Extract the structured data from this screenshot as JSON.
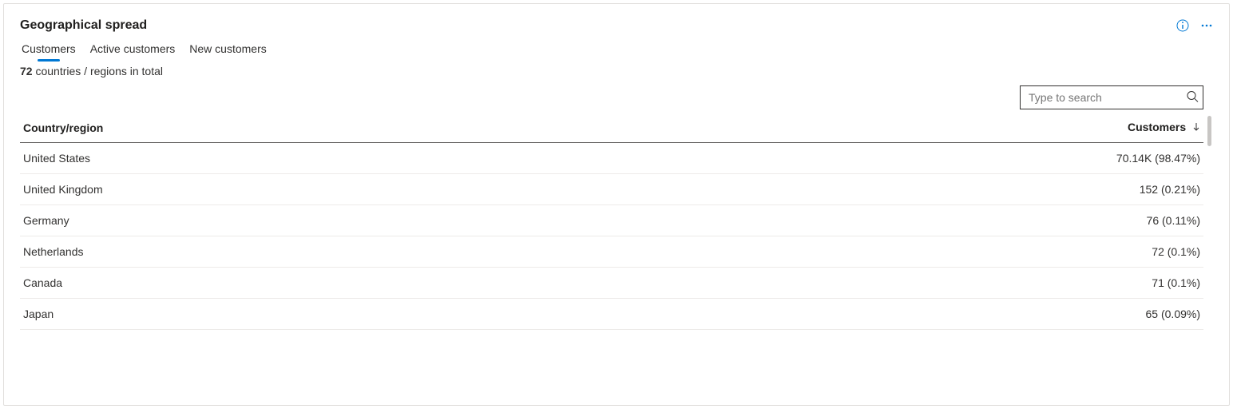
{
  "card": {
    "title": "Geographical spread"
  },
  "tabs": [
    {
      "label": "Customers",
      "selected": true
    },
    {
      "label": "Active customers",
      "selected": false
    },
    {
      "label": "New customers",
      "selected": false
    }
  ],
  "summary": {
    "count": "72",
    "suffix": "countries / regions in total"
  },
  "search": {
    "placeholder": "Type to search"
  },
  "table": {
    "columns": {
      "country": "Country/region",
      "customers": "Customers"
    },
    "rows": [
      {
        "country": "United States",
        "value": "70.14K (98.47%)"
      },
      {
        "country": "United Kingdom",
        "value": "152 (0.21%)"
      },
      {
        "country": "Germany",
        "value": "76 (0.11%)"
      },
      {
        "country": "Netherlands",
        "value": "72 (0.1%)"
      },
      {
        "country": "Canada",
        "value": "71 (0.1%)"
      },
      {
        "country": "Japan",
        "value": "65 (0.09%)"
      }
    ]
  }
}
